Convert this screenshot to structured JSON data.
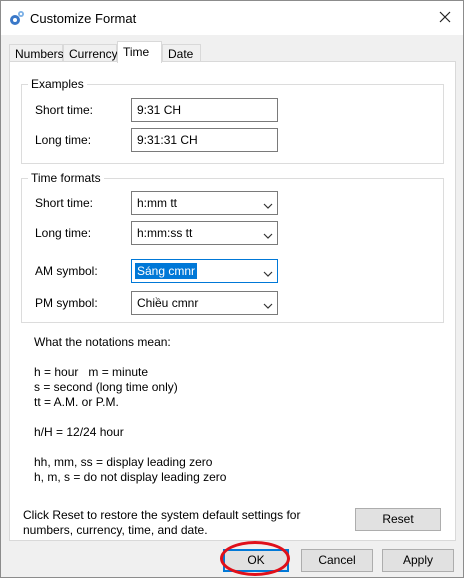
{
  "window": {
    "title": "Customize Format"
  },
  "tabs": [
    {
      "label": "Numbers"
    },
    {
      "label": "Currency"
    },
    {
      "label": "Time"
    },
    {
      "label": "Date"
    }
  ],
  "examples": {
    "legend": "Examples",
    "short_time_label": "Short time:",
    "short_time_value": "9:31 CH",
    "long_time_label": "Long time:",
    "long_time_value": "9:31:31 CH"
  },
  "formats": {
    "legend": "Time formats",
    "short_time_label": "Short time:",
    "short_time_value": "h:mm tt",
    "long_time_label": "Long time:",
    "long_time_value": "h:mm:ss tt",
    "am_label": "AM symbol:",
    "am_value": "Sáng cmnr",
    "pm_label": "PM symbol:",
    "pm_value": "Chiều cmnr"
  },
  "notations": {
    "heading": "What the notations mean:",
    "lines": [
      "h = hour   m = minute",
      "s = second (long time only)",
      "tt = A.M. or P.M."
    ],
    "hh_line": "h/H = 12/24 hour",
    "zero_lines": [
      "hh, mm, ss = display leading zero",
      "h, m, s = do not display leading zero"
    ]
  },
  "reset": {
    "text_line1": "Click Reset to restore the system default settings for",
    "text_line2": "numbers, currency, time, and date.",
    "button": "Reset"
  },
  "footer": {
    "ok": "OK",
    "cancel": "Cancel",
    "apply": "Apply"
  },
  "colors": {
    "accent": "#0078d7",
    "annotation_ring": "#e0101a"
  },
  "state": {
    "active_tab": "Time",
    "focused_field": "AM symbol"
  }
}
